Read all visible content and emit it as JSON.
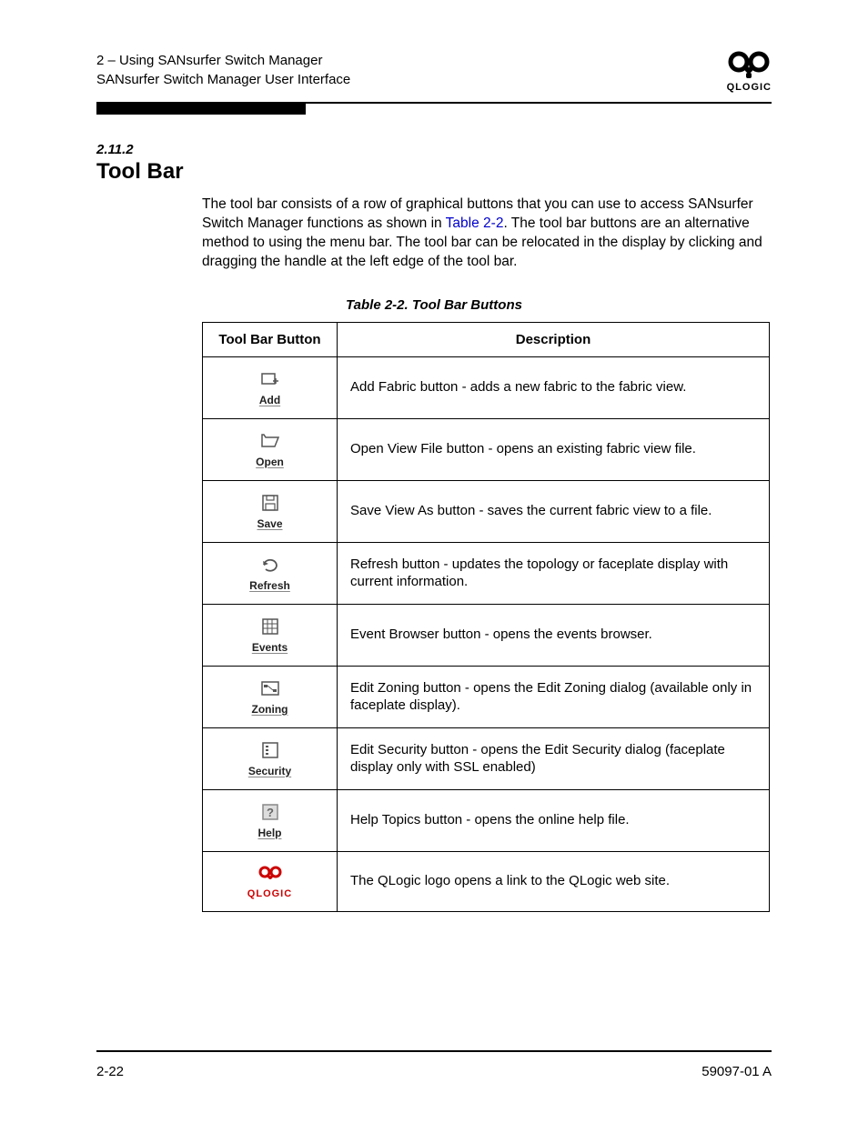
{
  "header": {
    "line1": "2 – Using SANsurfer Switch Manager",
    "line2": "SANsurfer Switch Manager User Interface",
    "logo_label": "QLOGIC"
  },
  "section": {
    "number": "2.11.2",
    "title": "Tool Bar",
    "body_pre": "The tool bar consists of a row of graphical buttons that you can use to access SANsurfer Switch Manager functions as shown in ",
    "body_link": "Table 2-2",
    "body_post": ". The tool bar buttons are an alternative method to using the menu bar. The tool bar can be relocated in the display by clicking and dragging the handle at the left edge of the tool bar."
  },
  "table": {
    "caption": "Table 2-2. Tool Bar Buttons",
    "col1": "Tool Bar Button",
    "col2": "Description",
    "rows": [
      {
        "icon": "add",
        "label": "Add",
        "desc": "Add Fabric button - adds a new fabric to the fabric view."
      },
      {
        "icon": "open",
        "label": "Open",
        "desc": "Open View File button - opens an existing fabric view file."
      },
      {
        "icon": "save",
        "label": "Save",
        "desc": "Save View As button - saves the current fabric view to a file."
      },
      {
        "icon": "refresh",
        "label": "Refresh",
        "desc": "Refresh button - updates the topology or faceplate display with current information."
      },
      {
        "icon": "events",
        "label": "Events",
        "desc": "Event Browser button - opens the events browser."
      },
      {
        "icon": "zoning",
        "label": "Zoning",
        "desc": "Edit Zoning button - opens the Edit Zoning dialog (available only in faceplate display)."
      },
      {
        "icon": "security",
        "label": "Security",
        "desc": "Edit Security button - opens the Edit Security dialog (faceplate display only with SSL enabled)"
      },
      {
        "icon": "help",
        "label": "Help",
        "desc": "Help Topics button - opens the online help file."
      },
      {
        "icon": "qlogic",
        "label": "QLOGIC",
        "desc": "The QLogic logo opens a link to the QLogic web site."
      }
    ]
  },
  "footer": {
    "left": "2-22",
    "right": "59097-01 A"
  }
}
